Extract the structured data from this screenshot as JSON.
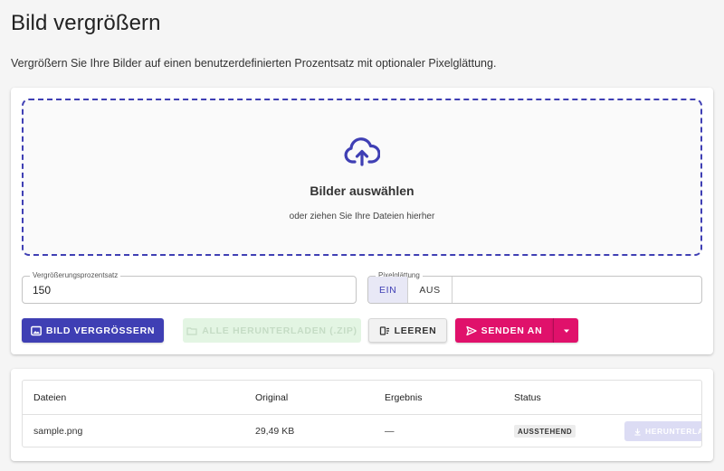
{
  "page": {
    "title": "Bild vergrößern",
    "description": "Vergrößern Sie Ihre Bilder auf einen benutzerdefinierten Prozentsatz mit optionaler Pixelglättung."
  },
  "dropzone": {
    "icon": "cloud-upload-icon",
    "title": "Bilder auswählen",
    "subtitle": "oder ziehen Sie Ihre Dateien hierher"
  },
  "form": {
    "percent_label": "Vergrößerungsprozentsatz",
    "percent_value": "150",
    "smoothing_label": "Pixelglättung",
    "smoothing_options": [
      "EIN",
      "AUS"
    ],
    "smoothing_selected": "EIN"
  },
  "actions": {
    "enlarge": "BILD VERGRÖSSERN",
    "download_all": "ALLE HERUNTERLADEN (.ZIP)",
    "clear": "LEEREN",
    "send": "SENDEN AN"
  },
  "table": {
    "headers": [
      "Dateien",
      "Original",
      "Ergebnis",
      "Status"
    ],
    "rows": [
      {
        "file": "sample.png",
        "original": "29,49 KB",
        "result": "—",
        "status": "AUSSTEHEND",
        "action": "HERUNTERLADEN"
      }
    ]
  },
  "colors": {
    "primary": "#3f3fb4",
    "accent": "#e0116b",
    "disabled_green": "#e3f5e3",
    "background": "#f5f5f5"
  }
}
